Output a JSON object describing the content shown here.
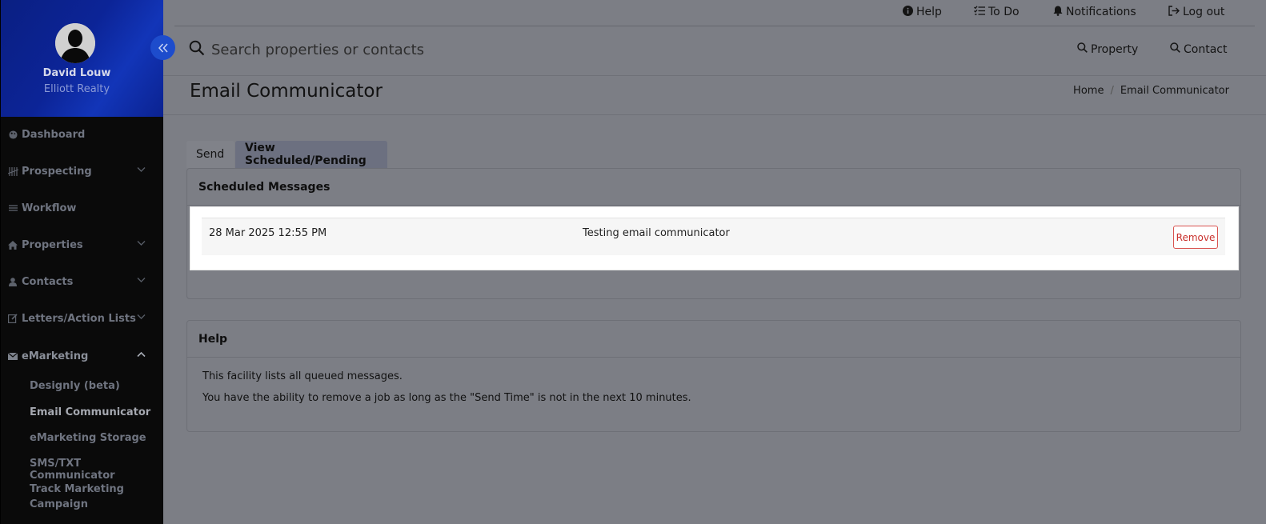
{
  "profile": {
    "name": "David Louw",
    "company": "Elliott Realty"
  },
  "sidebar": {
    "collapse_icon": "double-chevron-left-icon",
    "items": [
      {
        "label": "Dashboard",
        "icon": "palette-icon"
      },
      {
        "label": "Prospecting",
        "icon": "tally-icon",
        "expandable": true
      },
      {
        "label": "Workflow",
        "icon": "list-icon"
      },
      {
        "label": "Properties",
        "icon": "home-icon",
        "expandable": true
      },
      {
        "label": "Contacts",
        "icon": "person-icon",
        "expandable": true
      },
      {
        "label": "Letters/Action Lists",
        "icon": "edit-icon",
        "expandable": true
      },
      {
        "label": "eMarketing",
        "icon": "envelope-icon",
        "expandable": true,
        "expanded": true
      }
    ],
    "sub_items": [
      {
        "label": "Designly (beta)"
      },
      {
        "label": "Email Communicator",
        "active": true
      },
      {
        "label": "eMarketing Storage"
      },
      {
        "label": "SMS/TXT Communicator"
      },
      {
        "label": "Track Marketing"
      },
      {
        "label": "Campaign"
      }
    ]
  },
  "header": {
    "links": {
      "help": "Help",
      "todo": "To Do",
      "notifications": "Notifications",
      "logout": "Log out"
    },
    "search": {
      "placeholder": "Search properties or contacts",
      "property": "Property",
      "contact": "Contact"
    }
  },
  "page": {
    "title": "Email Communicator",
    "breadcrumb": {
      "home": "Home",
      "separator": "/",
      "current": "Email Communicator"
    }
  },
  "tabs": {
    "send": "Send",
    "scheduled": "View Scheduled/Pending"
  },
  "scheduled": {
    "header": "Scheduled Messages",
    "messages": [
      {
        "date": "28 Mar 2025 12:55 PM",
        "subject": "Testing email communicator",
        "action": "Remove"
      }
    ]
  },
  "help": {
    "header": "Help",
    "line1": "This facility lists all queued messages.",
    "line2": "You have the ability to remove a job as long as the \"Send Time\" is not in the next 10 minutes."
  },
  "colors": {
    "sidebar_bg": "#0a0a0a",
    "profile_bg": "#0c2497",
    "collapse_btn": "#1d4ccc",
    "remove_btn": "#d9534f",
    "overlay_bg": "#7c7e85"
  }
}
